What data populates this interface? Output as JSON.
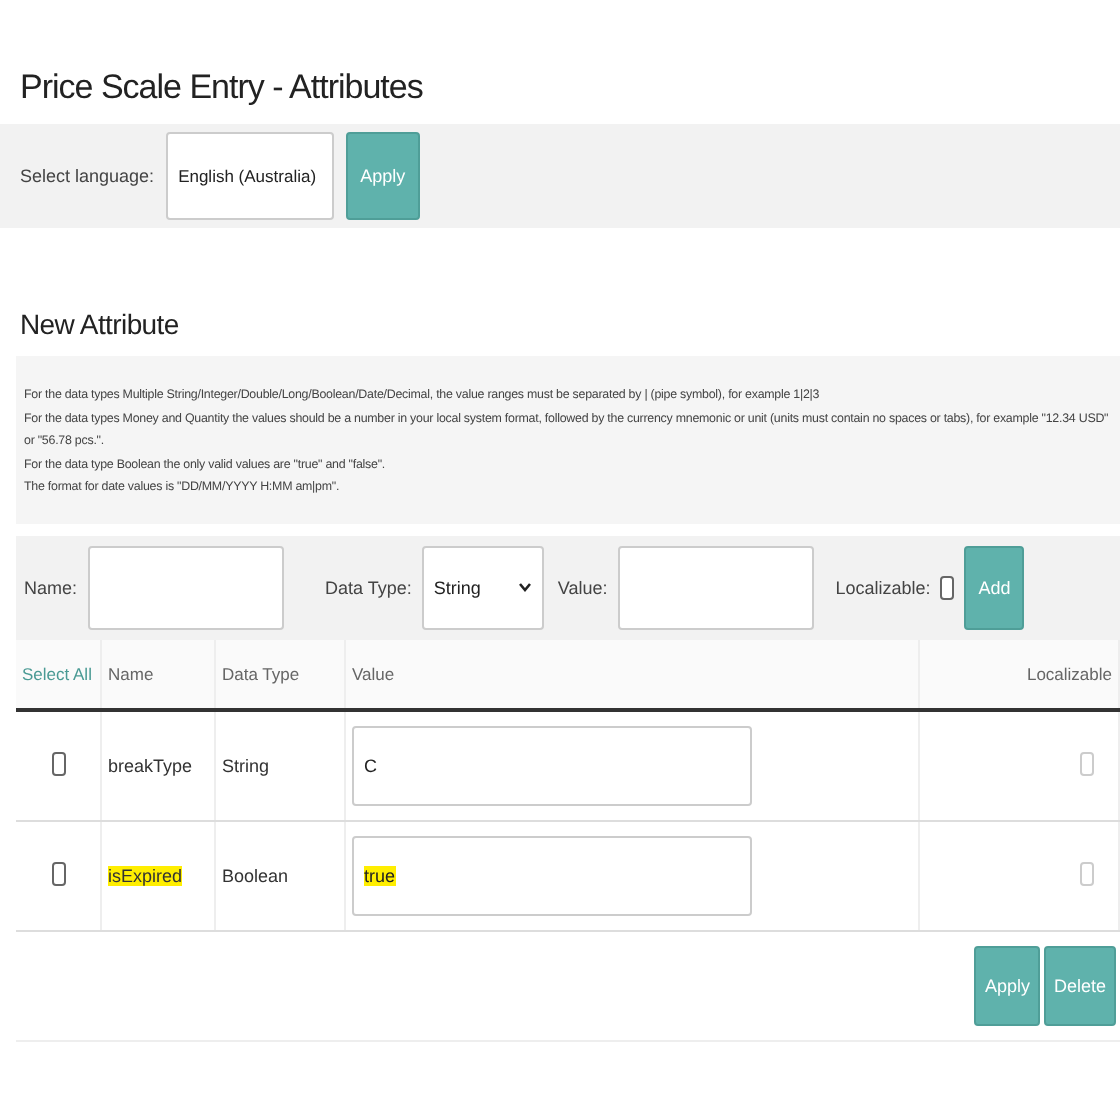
{
  "page_title": "Price Scale Entry - Attributes",
  "language_bar": {
    "label": "Select language:",
    "value": "English (Australia)",
    "button": "Apply"
  },
  "section_title": "New Attribute",
  "notes": [
    "For the data types Multiple String/Integer/Double/Long/Boolean/Date/Decimal, the value ranges must be separated by | (pipe symbol), for example 1|2|3",
    "For the data types Money and Quantity the values should be a number in your local system format, followed by the currency mnemonic or unit (units must contain no spaces or tabs), for example \"12.34 USD\" or \"56.78 pcs.\".",
    "For the data type Boolean the only valid values are \"true\" and \"false\".",
    "The format for date values is \"DD/MM/YYYY H:MM am|pm\"."
  ],
  "new_attribute_form": {
    "name_label": "Name:",
    "data_type_label": "Data Type:",
    "data_type_value": "String",
    "value_label": "Value:",
    "localizable_label": "Localizable:",
    "localizable_checked": false,
    "add_button": "Add"
  },
  "table": {
    "columns": [
      "Select All",
      "Name",
      "Data Type",
      "Value",
      "Localizable"
    ],
    "rows": [
      {
        "checked": false,
        "name": "breakType",
        "data_type": "String",
        "value": "C",
        "localizable": false,
        "highlighted": false
      },
      {
        "checked": false,
        "name": "isExpired",
        "data_type": "Boolean",
        "value": "true",
        "localizable": false,
        "highlighted": true
      }
    ]
  },
  "footer_buttons": [
    "Apply",
    "Delete"
  ]
}
